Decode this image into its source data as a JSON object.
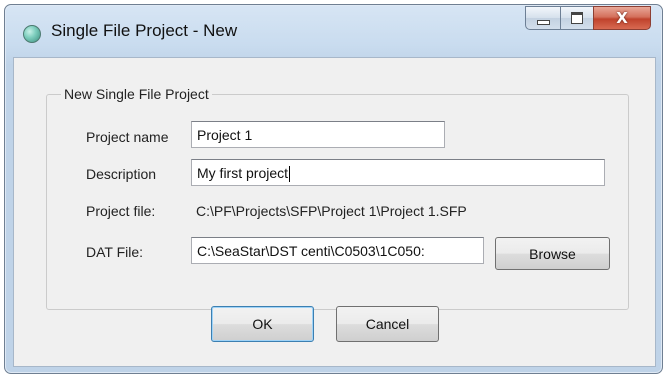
{
  "window": {
    "title": "Single File Project - New",
    "controls": {
      "minimize": "minimize-icon",
      "maximize": "maximize-icon",
      "close": "close-icon",
      "close_glyph": "X"
    }
  },
  "group": {
    "legend": "New Single File Project"
  },
  "form": {
    "project_name": {
      "label": "Project name",
      "value": "Project 1"
    },
    "description": {
      "label": "Description",
      "value": "My first project"
    },
    "project_file": {
      "label": "Project file:",
      "value": "C:\\PF\\Projects\\SFP\\Project 1\\Project 1.SFP"
    },
    "dat_file": {
      "label": "DAT File:",
      "value": "C:\\SeaStar\\DST centi\\C0503\\1C050:"
    },
    "browse_label": "Browse"
  },
  "buttons": {
    "ok": "OK",
    "cancel": "Cancel"
  },
  "colors": {
    "title_bar": "#c9dcef",
    "close_button": "#c0432c",
    "dialog_body": "#f0f0f0"
  }
}
